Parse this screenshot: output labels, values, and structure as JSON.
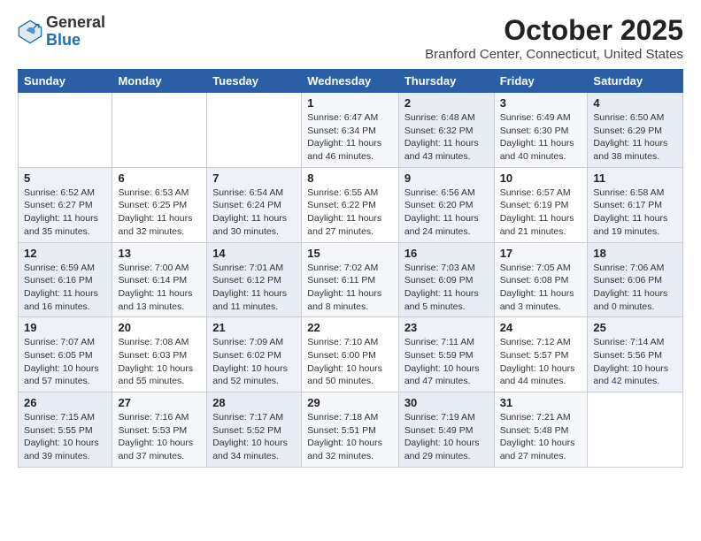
{
  "header": {
    "logo_general": "General",
    "logo_blue": "Blue",
    "month_title": "October 2025",
    "location": "Branford Center, Connecticut, United States"
  },
  "days_of_week": [
    "Sunday",
    "Monday",
    "Tuesday",
    "Wednesday",
    "Thursday",
    "Friday",
    "Saturday"
  ],
  "weeks": [
    [
      {
        "day": "",
        "info": ""
      },
      {
        "day": "",
        "info": ""
      },
      {
        "day": "",
        "info": ""
      },
      {
        "day": "1",
        "info": "Sunrise: 6:47 AM\nSunset: 6:34 PM\nDaylight: 11 hours and 46 minutes."
      },
      {
        "day": "2",
        "info": "Sunrise: 6:48 AM\nSunset: 6:32 PM\nDaylight: 11 hours and 43 minutes."
      },
      {
        "day": "3",
        "info": "Sunrise: 6:49 AM\nSunset: 6:30 PM\nDaylight: 11 hours and 40 minutes."
      },
      {
        "day": "4",
        "info": "Sunrise: 6:50 AM\nSunset: 6:29 PM\nDaylight: 11 hours and 38 minutes."
      }
    ],
    [
      {
        "day": "5",
        "info": "Sunrise: 6:52 AM\nSunset: 6:27 PM\nDaylight: 11 hours and 35 minutes."
      },
      {
        "day": "6",
        "info": "Sunrise: 6:53 AM\nSunset: 6:25 PM\nDaylight: 11 hours and 32 minutes."
      },
      {
        "day": "7",
        "info": "Sunrise: 6:54 AM\nSunset: 6:24 PM\nDaylight: 11 hours and 30 minutes."
      },
      {
        "day": "8",
        "info": "Sunrise: 6:55 AM\nSunset: 6:22 PM\nDaylight: 11 hours and 27 minutes."
      },
      {
        "day": "9",
        "info": "Sunrise: 6:56 AM\nSunset: 6:20 PM\nDaylight: 11 hours and 24 minutes."
      },
      {
        "day": "10",
        "info": "Sunrise: 6:57 AM\nSunset: 6:19 PM\nDaylight: 11 hours and 21 minutes."
      },
      {
        "day": "11",
        "info": "Sunrise: 6:58 AM\nSunset: 6:17 PM\nDaylight: 11 hours and 19 minutes."
      }
    ],
    [
      {
        "day": "12",
        "info": "Sunrise: 6:59 AM\nSunset: 6:16 PM\nDaylight: 11 hours and 16 minutes."
      },
      {
        "day": "13",
        "info": "Sunrise: 7:00 AM\nSunset: 6:14 PM\nDaylight: 11 hours and 13 minutes."
      },
      {
        "day": "14",
        "info": "Sunrise: 7:01 AM\nSunset: 6:12 PM\nDaylight: 11 hours and 11 minutes."
      },
      {
        "day": "15",
        "info": "Sunrise: 7:02 AM\nSunset: 6:11 PM\nDaylight: 11 hours and 8 minutes."
      },
      {
        "day": "16",
        "info": "Sunrise: 7:03 AM\nSunset: 6:09 PM\nDaylight: 11 hours and 5 minutes."
      },
      {
        "day": "17",
        "info": "Sunrise: 7:05 AM\nSunset: 6:08 PM\nDaylight: 11 hours and 3 minutes."
      },
      {
        "day": "18",
        "info": "Sunrise: 7:06 AM\nSunset: 6:06 PM\nDaylight: 11 hours and 0 minutes."
      }
    ],
    [
      {
        "day": "19",
        "info": "Sunrise: 7:07 AM\nSunset: 6:05 PM\nDaylight: 10 hours and 57 minutes."
      },
      {
        "day": "20",
        "info": "Sunrise: 7:08 AM\nSunset: 6:03 PM\nDaylight: 10 hours and 55 minutes."
      },
      {
        "day": "21",
        "info": "Sunrise: 7:09 AM\nSunset: 6:02 PM\nDaylight: 10 hours and 52 minutes."
      },
      {
        "day": "22",
        "info": "Sunrise: 7:10 AM\nSunset: 6:00 PM\nDaylight: 10 hours and 50 minutes."
      },
      {
        "day": "23",
        "info": "Sunrise: 7:11 AM\nSunset: 5:59 PM\nDaylight: 10 hours and 47 minutes."
      },
      {
        "day": "24",
        "info": "Sunrise: 7:12 AM\nSunset: 5:57 PM\nDaylight: 10 hours and 44 minutes."
      },
      {
        "day": "25",
        "info": "Sunrise: 7:14 AM\nSunset: 5:56 PM\nDaylight: 10 hours and 42 minutes."
      }
    ],
    [
      {
        "day": "26",
        "info": "Sunrise: 7:15 AM\nSunset: 5:55 PM\nDaylight: 10 hours and 39 minutes."
      },
      {
        "day": "27",
        "info": "Sunrise: 7:16 AM\nSunset: 5:53 PM\nDaylight: 10 hours and 37 minutes."
      },
      {
        "day": "28",
        "info": "Sunrise: 7:17 AM\nSunset: 5:52 PM\nDaylight: 10 hours and 34 minutes."
      },
      {
        "day": "29",
        "info": "Sunrise: 7:18 AM\nSunset: 5:51 PM\nDaylight: 10 hours and 32 minutes."
      },
      {
        "day": "30",
        "info": "Sunrise: 7:19 AM\nSunset: 5:49 PM\nDaylight: 10 hours and 29 minutes."
      },
      {
        "day": "31",
        "info": "Sunrise: 7:21 AM\nSunset: 5:48 PM\nDaylight: 10 hours and 27 minutes."
      },
      {
        "day": "",
        "info": ""
      }
    ]
  ]
}
